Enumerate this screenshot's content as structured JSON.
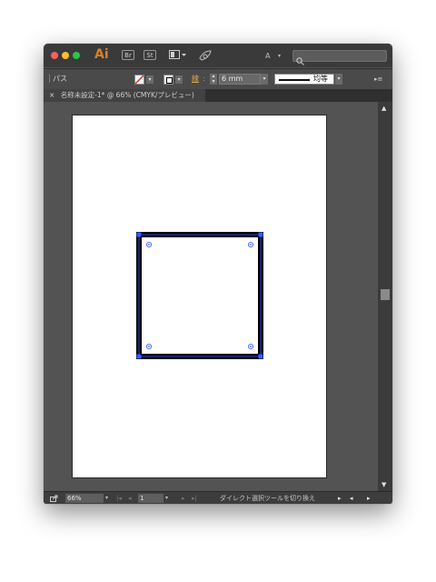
{
  "app": {
    "logo": "Ai",
    "bridge_label": "Br",
    "stock_label": "St"
  },
  "toolbar": {
    "selection_label": "パス",
    "stroke_label": "線",
    "stroke_weight": "6 mm",
    "profile_label": "均等"
  },
  "search": {
    "type_label": "A"
  },
  "document": {
    "close_glyph": "×",
    "tab_title": "名称未設定-1* @ 66% (CMYK/プレビュー)"
  },
  "status": {
    "zoom": "66%",
    "artboard_number": "1",
    "current_tool_hint": "ダイレクト選択ツールを切り換え"
  },
  "colors": {
    "stroke": "#000000",
    "selection": "#3b5bff",
    "artboard": "#ffffff",
    "chrome": "#535353"
  },
  "icons": [
    "workspace-icon",
    "gpu-rocket-icon",
    "search-icon",
    "panel-menu-icon",
    "none-fill-icon",
    "stroke-swatch-icon",
    "share-icon"
  ]
}
